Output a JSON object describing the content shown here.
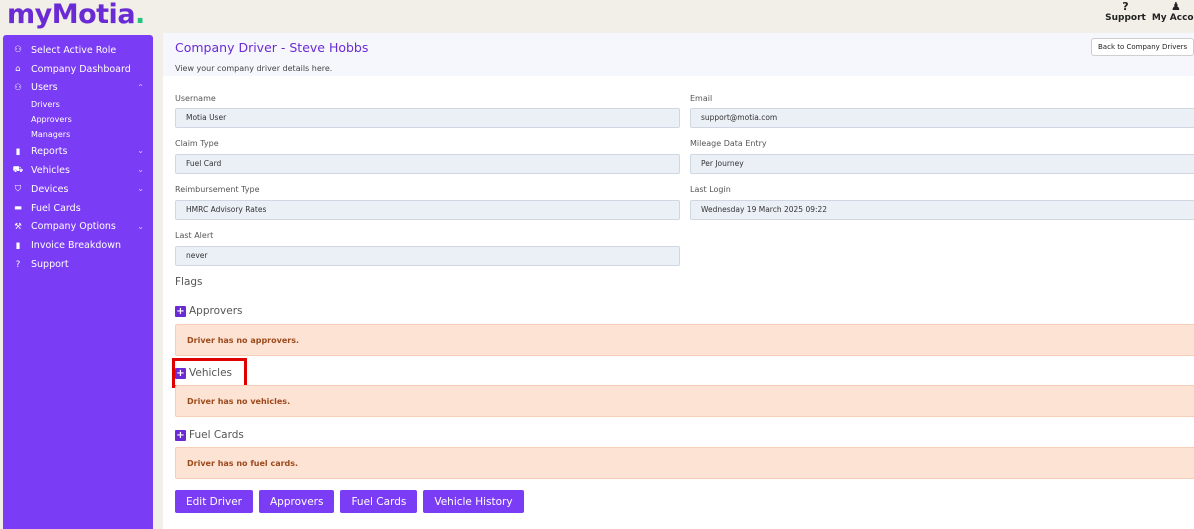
{
  "brand": {
    "prefix": "my",
    "name": "Motia",
    "dot": "."
  },
  "top_links": [
    {
      "icon": "?",
      "label": "Support"
    },
    {
      "icon": "♟",
      "label": "My Accou"
    }
  ],
  "sidebar": {
    "items": [
      {
        "icon": "users-icon",
        "glyph": "⚇",
        "label": "Select Active Role"
      },
      {
        "icon": "building-icon",
        "glyph": "⌂",
        "label": "Company Dashboard"
      },
      {
        "icon": "users-icon",
        "glyph": "⚇",
        "label": "Users",
        "chevron": "⌃"
      },
      {
        "icon": "file-icon",
        "glyph": "▮",
        "label": "Reports",
        "chevron": "⌄"
      },
      {
        "icon": "truck-icon",
        "glyph": "⛟",
        "label": "Vehicles",
        "chevron": "⌄"
      },
      {
        "icon": "cart-icon",
        "glyph": "⛉",
        "label": "Devices",
        "chevron": "⌄"
      },
      {
        "icon": "card-icon",
        "glyph": "▬",
        "label": "Fuel Cards"
      },
      {
        "icon": "wrench-icon",
        "glyph": "⚒",
        "label": "Company Options",
        "chevron": "⌄"
      },
      {
        "icon": "file-icon",
        "glyph": "▮",
        "label": "Invoice Breakdown"
      },
      {
        "icon": "question-icon",
        "glyph": "?",
        "label": "Support"
      }
    ],
    "users_sub": [
      "Drivers",
      "Approvers",
      "Managers"
    ]
  },
  "header": {
    "title": "Company Driver - Steve Hobbs",
    "subtitle": "View your company driver details here.",
    "back_button": "Back to Company Drivers"
  },
  "fields": {
    "username": {
      "label": "Username",
      "value": "Motia User"
    },
    "email": {
      "label": "Email",
      "value": "support@motia.com"
    },
    "claim_type": {
      "label": "Claim Type",
      "value": "Fuel Card"
    },
    "mileage": {
      "label": "Mileage Data Entry",
      "value": "Per Journey"
    },
    "reimbursement": {
      "label": "Reimbursement Type",
      "value": "HMRC Advisory Rates"
    },
    "last_login": {
      "label": "Last Login",
      "value": "Wednesday 19 March 2025 09:22"
    },
    "last_alert": {
      "label": "Last Alert",
      "value": "never"
    }
  },
  "flags": {
    "title": "Flags",
    "approvers": {
      "label": "Approvers",
      "alert": "Driver has no approvers."
    },
    "vehicles": {
      "label": "Vehicles",
      "alert": "Driver has no vehicles."
    },
    "fuel_cards": {
      "label": "Fuel Cards",
      "alert": "Driver has no fuel cards."
    }
  },
  "actions": {
    "edit": "Edit Driver",
    "approvers": "Approvers",
    "fuel_cards": "Fuel Cards",
    "history": "Vehicle History"
  },
  "colors": {
    "accent": "#7a3cf5",
    "brand": "#6b2bd4",
    "alert_bg": "#fde3d4",
    "highlight": "#e00000"
  }
}
